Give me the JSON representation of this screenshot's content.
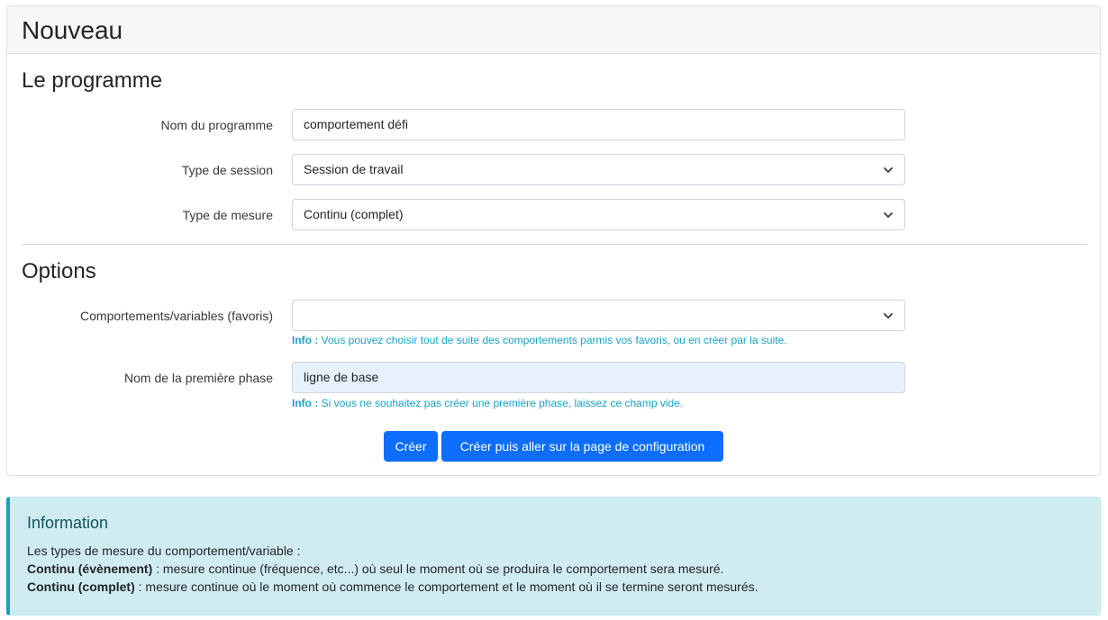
{
  "card": {
    "title": "Nouveau"
  },
  "programme": {
    "section_title": "Le programme",
    "name_label": "Nom du programme",
    "name_value": "comportement défi",
    "session_label": "Type de session",
    "session_value": "Session de travail",
    "measure_label": "Type de mesure",
    "measure_value": "Continu (complet)"
  },
  "options": {
    "section_title": "Options",
    "favorites_label": "Comportements/variables (favoris)",
    "favorites_value": "",
    "favorites_help_prefix": "Info :",
    "favorites_help_text": " Vous pouvez choisir tout de suite des comportements parmis vos favoris, ou en créer par la suite.",
    "phase_label": "Nom de la première phase",
    "phase_value": "ligne de base",
    "phase_help_prefix": "Info :",
    "phase_help_text": " Si vous ne souhaitez pas créer une première phase, laissez ce champ vide."
  },
  "actions": {
    "create_label": "Créer",
    "create_config_label": "Créer puis aller sur la page de configuration"
  },
  "info": {
    "title": "Information",
    "intro": "Les types de mesure du comportement/variable :",
    "event_term": "Continu (évènement)",
    "event_desc": " : mesure continue (fréquence, etc...) où seul le moment où se produira le comportement sera mesuré.",
    "complete_term": "Continu (complet)",
    "complete_desc": " : mesure continue où le moment où commence le comportement et le moment où il se termine seront mesurés."
  },
  "colors": {
    "primary": "#0d6efd",
    "info_text": "#17a2c9",
    "alert_bg": "#d1ecf1"
  },
  "icons": {
    "select_chevron": "chevron-down-icon"
  }
}
